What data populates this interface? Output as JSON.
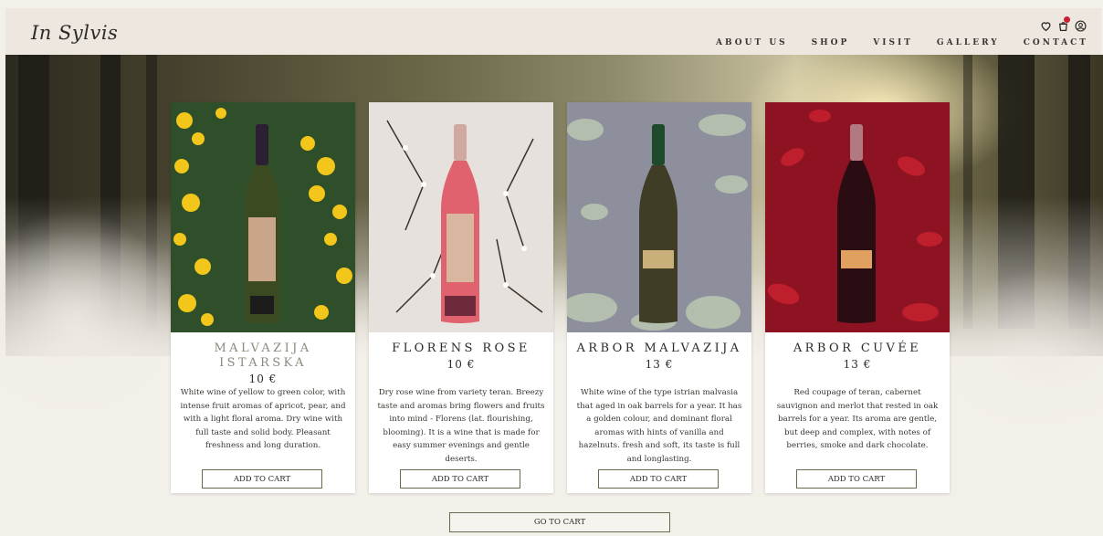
{
  "brand": {
    "logo_text": "In Sylvis"
  },
  "nav": {
    "items": [
      "ABOUT US",
      "SHOP",
      "VISIT",
      "GALLERY",
      "CONTACT"
    ]
  },
  "header_icons": [
    "heart-icon",
    "cart-icon",
    "user-icon"
  ],
  "products": [
    {
      "name_line1": "MALVAZIJA",
      "name_line2": "ISTARSKA",
      "price": "10 €",
      "description": "White wine of yellow to green color, with intense fruit aromas of apricot, pear, and with a light floral aroma. Dry wine with full taste and solid body. Pleasant freshness and long duration.",
      "button": "ADD TO CART",
      "bg_color": "#2f4f2a",
      "accent_color": "#f2c61a"
    },
    {
      "name_line1": "FLORENS ROSE",
      "name_line2": "",
      "price": "10 €",
      "description": "Dry rose wine from variety teran. Breezy taste and aromas bring flowers and fruits into mind - Florens (lat. flourishing, blooming). It is a wine that is made for easy summer evenings and gentle deserts.",
      "button": "ADD TO CART",
      "bg_color": "#e6e1dc",
      "accent_color": "#e0626e"
    },
    {
      "name_line1": "ARBOR MALVAZIJA",
      "name_line2": "",
      "price": "13 €",
      "description": "White wine of the type istrian malvasia that aged in oak barrels for a year. It has a golden colour, and dominant floral aromas with hints of vanilla and hazelnuts. fresh and soft, its taste is full and longlasting.",
      "button": "ADD TO CART",
      "bg_color": "#8d909c",
      "accent_color": "#1f4a2c"
    },
    {
      "name_line1": "ARBOR CUVÉE",
      "name_line2": "",
      "price": "13 €",
      "description": "Red coupage of teran, cabernet sauvignon and merlot that rested in oak barrels for a year. Its aroma are gentle, but deep and complex, with notes of berries, smoke and dark chocolate.",
      "button": "ADD TO CART",
      "bg_color": "#8e1322",
      "accent_color": "#3a0e14"
    }
  ],
  "go_to_cart": "GO TO CART"
}
